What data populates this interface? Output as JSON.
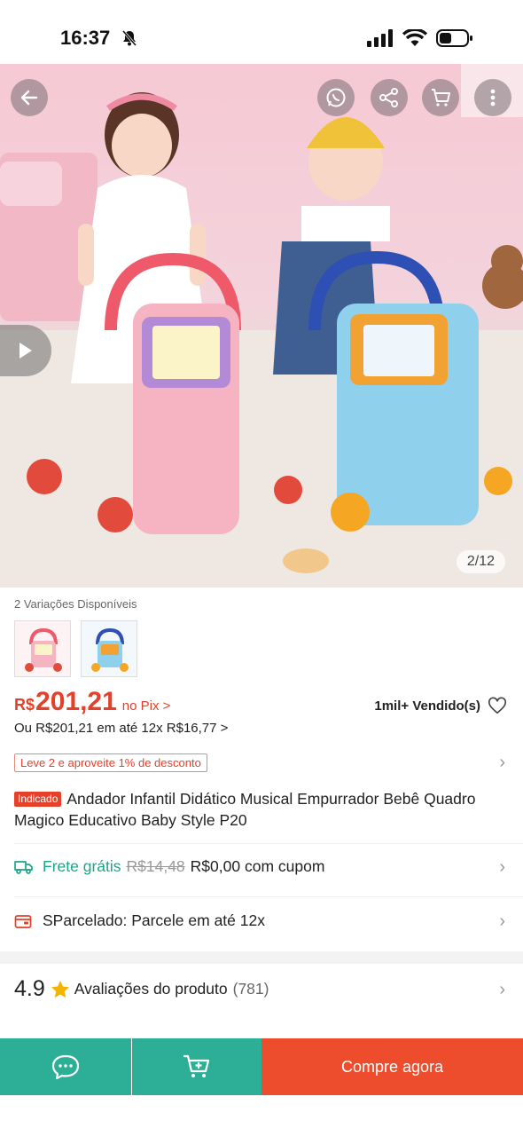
{
  "status_bar": {
    "time": "16:37"
  },
  "gallery": {
    "counter": "2/12"
  },
  "variations": {
    "label": "2 Variações Disponíveis"
  },
  "price": {
    "currency": "R$",
    "value": "201,21",
    "pix_label": "no Pix >",
    "sold": "1mil+ Vendido(s)",
    "installment": "Ou R$201,21 em até 12x R$16,77 >"
  },
  "promo": {
    "label": "Leve 2 e aproveite 1% de desconto"
  },
  "product": {
    "tag": "Indicado",
    "title": "Andador Infantil Didático Musical Empurrador Bebê Quadro Magico Educativo Baby Style P20"
  },
  "shipping": {
    "label": "Frete grátis",
    "old_price": "R$14,48",
    "new_price": "R$0,00 com cupom"
  },
  "installments_info": {
    "label": "SParcelado: Parcele em até 12x"
  },
  "rating": {
    "score": "4.9",
    "label": "Avaliações do produto",
    "count": "(781)"
  },
  "bottom_bar": {
    "buy_label": "Compre agora"
  },
  "colors": {
    "accent": "#ee4d2d",
    "teal": "#2cae97",
    "price_red": "#e4402a",
    "frete_green": "#1aa68a"
  }
}
